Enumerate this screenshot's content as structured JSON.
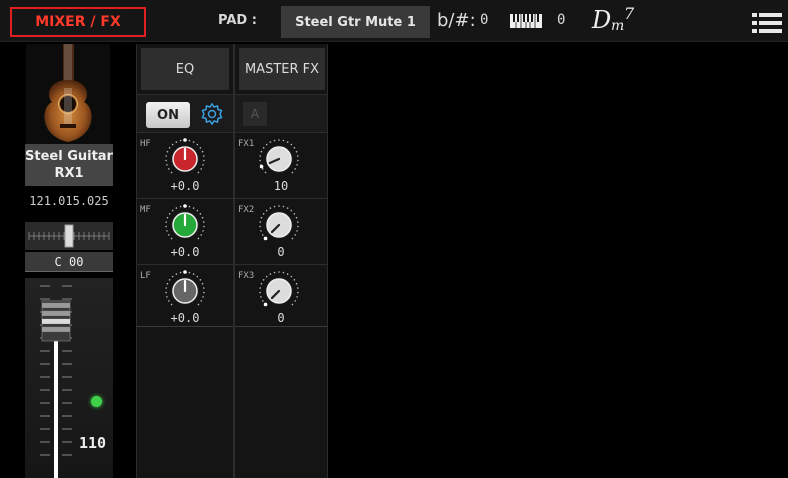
{
  "topbar": {
    "mode_tab": "MIXER / FX",
    "pad_label": "PAD :",
    "pad_name": "Steel Gtr Mute 1",
    "transpose_icon": "b/#:",
    "transpose_value": "0",
    "octave_value": "0",
    "chord": {
      "root": "D",
      "quality": "m",
      "extension": "7"
    },
    "icons": [
      "keyboard-icon",
      "menu-icon"
    ]
  },
  "channel": {
    "instrument_name": "Steel Guitar RX1",
    "bank_number": "121.015.025",
    "pan_value": "C 00",
    "pan_level": 0.5,
    "volume_value": "110",
    "volume_level": 0.86,
    "led_color": "#3fd14a"
  },
  "eq": {
    "tab_label": "EQ",
    "on_label": "ON",
    "settings_icon": "gear-icon",
    "bands": [
      {
        "label": "HF",
        "value": "+0.0",
        "level": 0.5,
        "color": "#c8262c"
      },
      {
        "label": "MF",
        "value": "+0.0",
        "level": 0.5,
        "color": "#25a83a"
      },
      {
        "label": "LF",
        "value": "+0.0",
        "level": 0.5,
        "color": "#666666"
      }
    ]
  },
  "master_fx": {
    "tab_label": "MASTER FX",
    "a_label": "A",
    "sends": [
      {
        "label": "FX1",
        "value": "10",
        "level": 0.08
      },
      {
        "label": "FX2",
        "value": "0",
        "level": 0.0
      },
      {
        "label": "FX3",
        "value": "0",
        "level": 0.0
      }
    ]
  },
  "colors": {
    "accent": "#ff3a2a",
    "background": "#000000"
  }
}
